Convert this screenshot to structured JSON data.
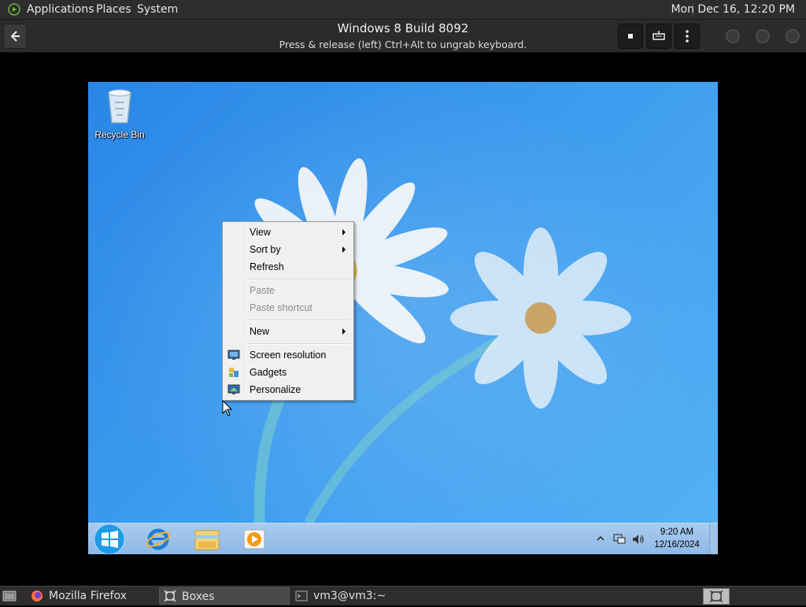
{
  "top_panel": {
    "menus": [
      "Applications",
      "Places",
      "System"
    ],
    "clock": "Mon Dec 16, 12:20 PM"
  },
  "headerbar": {
    "title": "Windows 8 Build 8092",
    "subtitle": "Press & release (left) Ctrl+Alt to ungrab keyboard.",
    "buttons": [
      "back-icon",
      "stop-icon",
      "keyboard-icon",
      "kebab-menu-icon"
    ]
  },
  "desktop": {
    "recycle_bin_label": "Recycle Bin"
  },
  "context_menu": {
    "items": [
      {
        "label": "View",
        "submenu": true,
        "disabled": false
      },
      {
        "label": "Sort by",
        "submenu": true,
        "disabled": false
      },
      {
        "label": "Refresh",
        "submenu": false,
        "disabled": false
      },
      {
        "label": "Paste",
        "submenu": false,
        "disabled": true
      },
      {
        "label": "Paste shortcut",
        "submenu": false,
        "disabled": true
      },
      {
        "label": "New",
        "submenu": true,
        "disabled": false
      },
      {
        "label": "Screen resolution",
        "icon": "monitor-icon",
        "disabled": false
      },
      {
        "label": "Gadgets",
        "icon": "gadgets-icon",
        "disabled": false
      },
      {
        "label": "Personalize",
        "icon": "personalize-icon",
        "disabled": false
      }
    ]
  },
  "win_taskbar": {
    "pinned": [
      "internet-explorer-icon",
      "file-explorer-icon",
      "media-player-icon"
    ],
    "tray_time": "9:20 AM",
    "tray_date": "12/16/2024"
  },
  "bottom_panel": {
    "tasks": [
      "Mozilla Firefox",
      "Boxes",
      "vm3@vm3:~"
    ]
  },
  "colors": {
    "panel_bg": "#2d2d2d",
    "wallpaper_blue": "#3c9bee",
    "menu_bg": "#f0f0f0",
    "taskbar_blue": "#9fc2ea"
  }
}
